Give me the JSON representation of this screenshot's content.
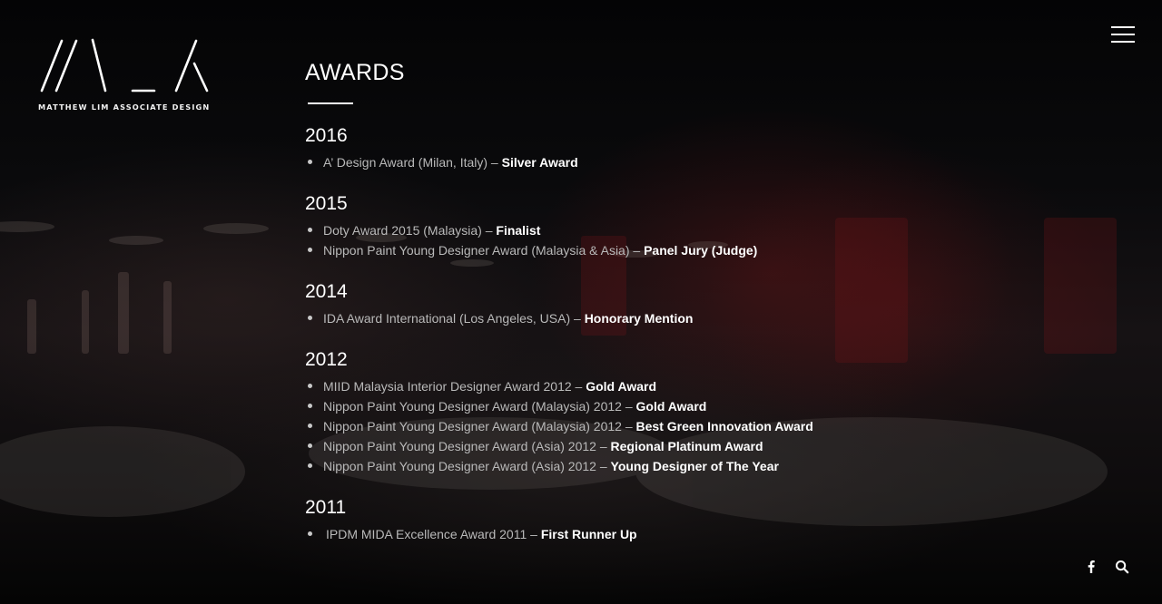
{
  "brand": {
    "caption": "MATTHEW LIM ASSOCIATE DESIGN"
  },
  "page": {
    "title": "AWARDS"
  },
  "awards": [
    {
      "year": "2016",
      "items": [
        {
          "name": "A’ Design Award (Milan, Italy) –",
          "result": "Silver Award"
        }
      ]
    },
    {
      "year": "2015",
      "items": [
        {
          "name": "Doty Award 2015 (Malaysia) –",
          "result": "Finalist"
        },
        {
          "name": "Nippon Paint Young Designer Award (Malaysia & Asia) –",
          "result": "Panel Jury (Judge)"
        }
      ]
    },
    {
      "year": "2014",
      "items": [
        {
          "name": "IDA Award International (Los Angeles, USA) –",
          "result": "Honorary Mention"
        }
      ]
    },
    {
      "year": "2012",
      "items": [
        {
          "name": "MIID Malaysia Interior Designer Award 2012 –",
          "result": "Gold Award"
        },
        {
          "name": "Nippon Paint Young Designer Award (Malaysia) 2012 –",
          "result": "Gold Award"
        },
        {
          "name": "Nippon Paint Young Designer Award (Malaysia) 2012 –",
          "result": "Best Green Innovation Award"
        },
        {
          "name": "Nippon Paint Young Designer Award (Asia) 2012 –",
          "result": "Regional Platinum Award"
        },
        {
          "name": "Nippon Paint Young Designer Award (Asia) 2012 –",
          "result": "Young Designer of The Year"
        }
      ]
    },
    {
      "year": "2011",
      "items": [
        {
          "name": "IPDM MIDA Excellence Award 2011 –",
          "result": "First Runner Up"
        }
      ]
    }
  ],
  "icons": {
    "menu": "hamburger-menu-icon",
    "facebook": "facebook-icon",
    "search": "search-icon"
  },
  "colors": {
    "background": "#0b0a0b",
    "text_primary": "#ffffff",
    "text_secondary": "#b9b9b9",
    "accent_red": "#7a1618"
  }
}
